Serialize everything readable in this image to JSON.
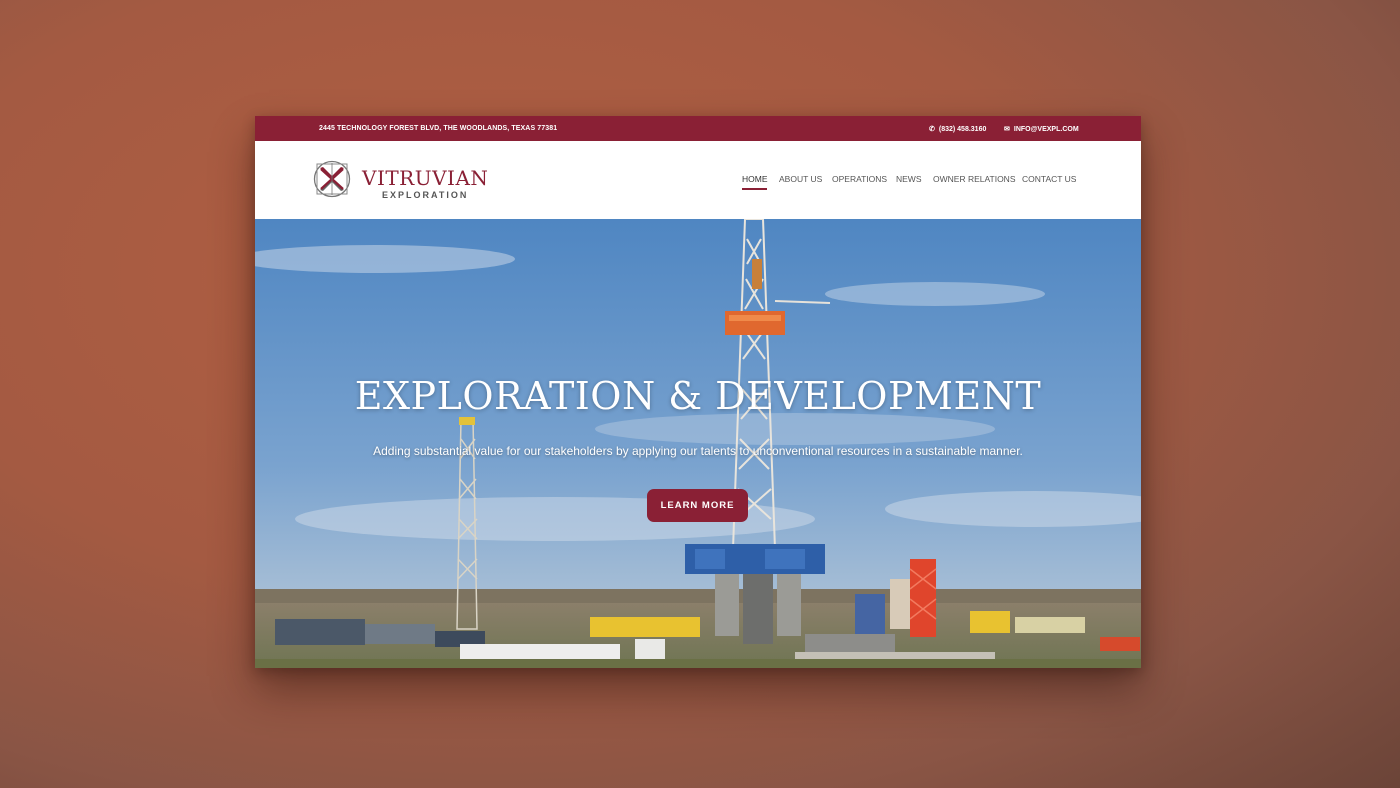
{
  "topbar": {
    "address": "2445 TECHNOLOGY FOREST BLVD, THE WOODLANDS, TEXAS 77381",
    "phone": "(832) 458.3160",
    "email": "INFO@VEXPL.COM",
    "phone_icon": "phone-icon",
    "email_icon": "envelope-icon"
  },
  "logo": {
    "name": "VITRUVIAN",
    "sub": "EXPLORATION"
  },
  "nav": {
    "items": [
      "HOME",
      "ABOUT US",
      "OPERATIONS",
      "NEWS",
      "OWNER RELATIONS",
      "CONTACT US"
    ],
    "active": "HOME"
  },
  "hero": {
    "title": "EXPLORATION & DEVELOPMENT",
    "subtitle": "Adding substantial value for our stakeholders by applying our talents to unconventional resources in a sustainable manner.",
    "cta_label": "LEARN MORE"
  },
  "colors": {
    "brand": "#8a2035",
    "background": "#a45a42"
  }
}
